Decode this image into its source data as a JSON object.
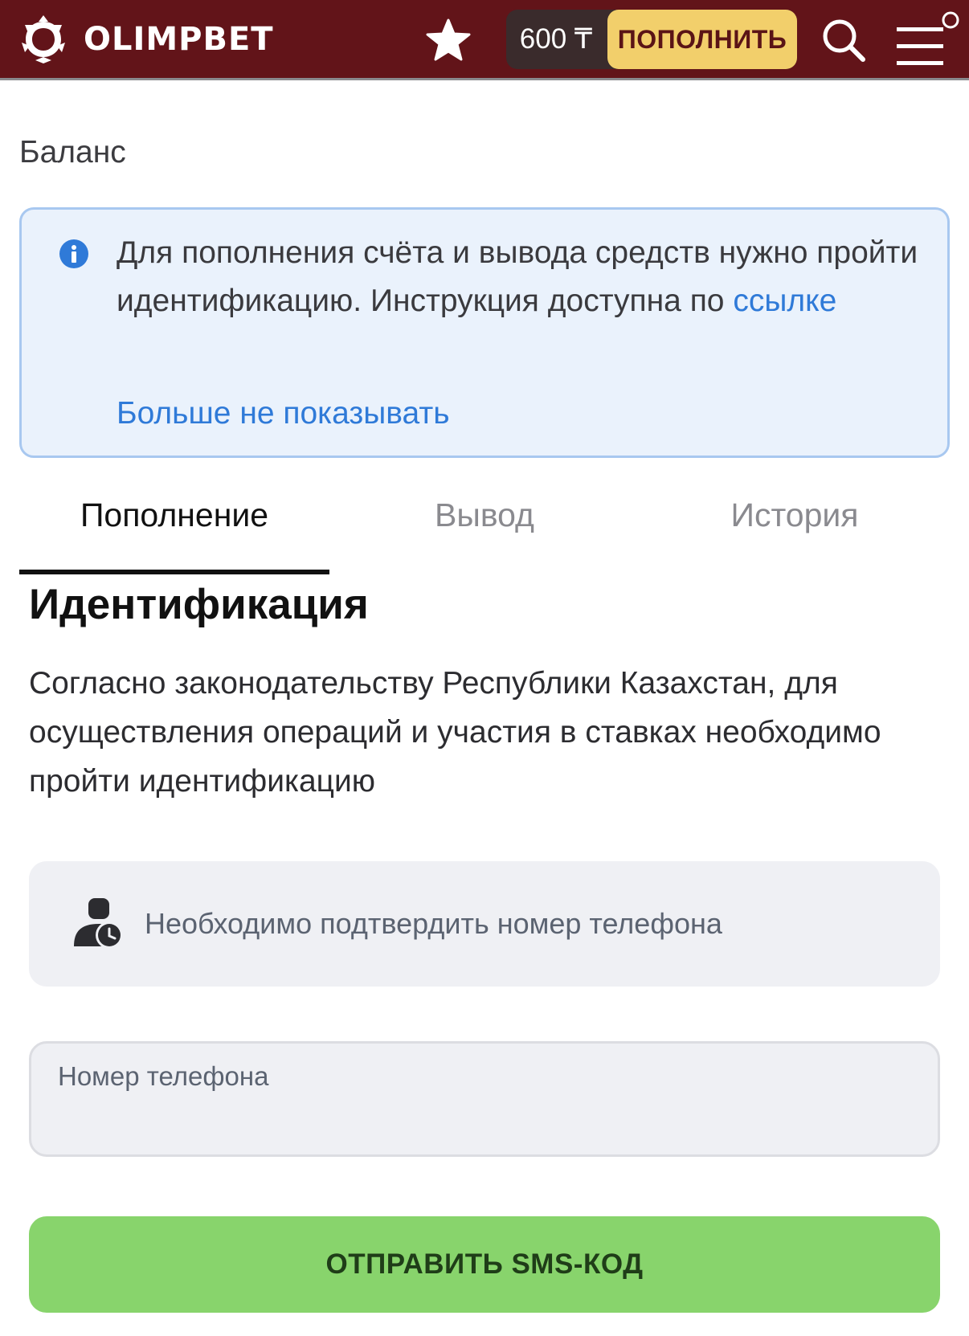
{
  "header": {
    "brand": "OLIMPBET",
    "balance": "600 ₸",
    "topup_label": "ПОПОЛНИТЬ",
    "background_color": "#621419",
    "accent_color": "#f2cf6b",
    "icons": {
      "logo": "olimpbet-logo-icon",
      "favorite": "star-icon",
      "search": "search-icon",
      "menu": "hamburger-menu-icon"
    }
  },
  "balance_title": "Баланс",
  "info": {
    "text": "Для пополнения счёта и вывода средств нужно пройти идентификацию. Инструкция доступна по ",
    "link": "ссылке",
    "dismiss": "Больше не показывать",
    "icon": "info-icon"
  },
  "tabs": [
    {
      "label": "Пополнение",
      "active": true
    },
    {
      "label": "Вывод",
      "active": false
    },
    {
      "label": "История",
      "active": false
    }
  ],
  "identification": {
    "title": "Идентификация",
    "description": "Согласно законодательству Республики Казахстан, для осуществления операций и участия в ставках необходимо пройти идентификацию",
    "notice": "Необходимо подтвердить номер телефона",
    "notice_icon": "user-clock-icon",
    "phone_label": "Номер телефона",
    "phone_value": "",
    "submit": "ОТПРАВИТЬ SMS-КОД",
    "submit_color": "#88d46c"
  }
}
